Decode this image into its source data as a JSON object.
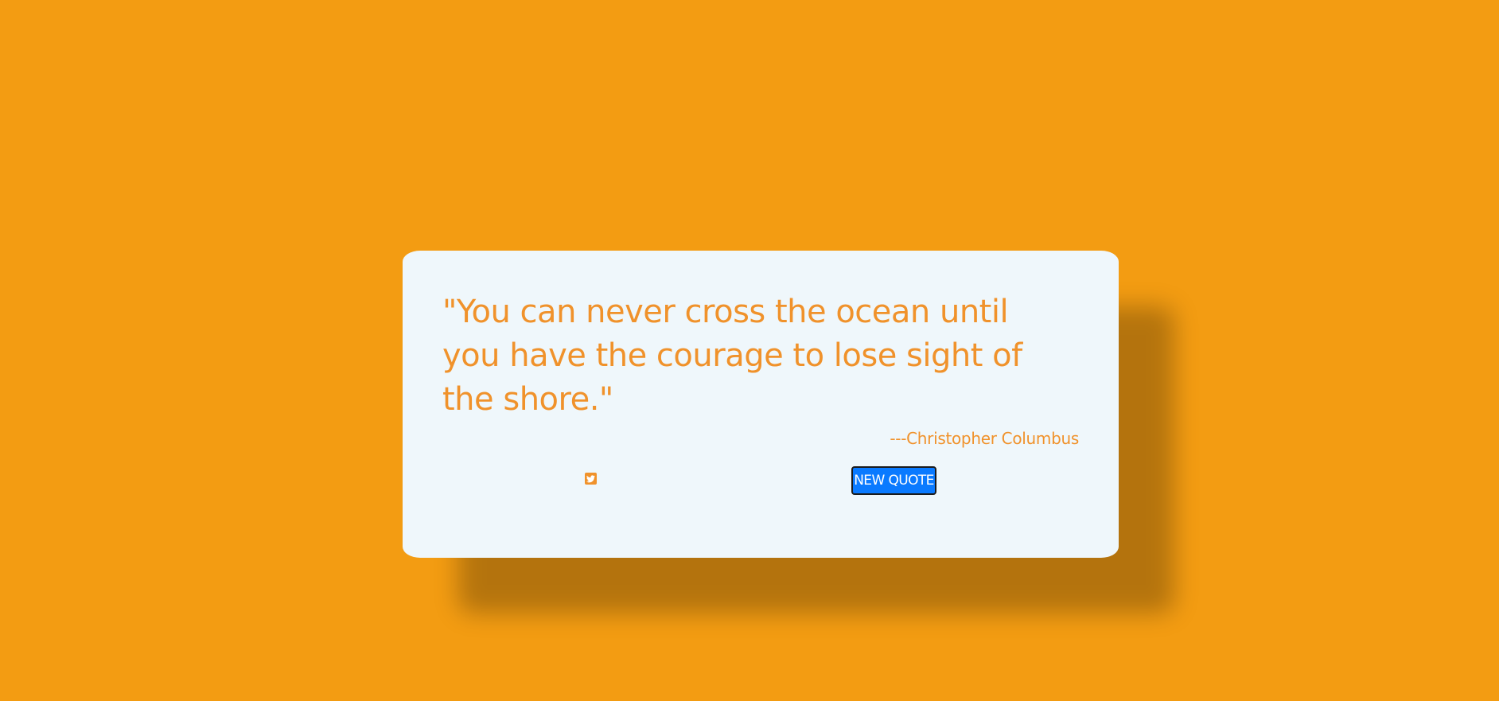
{
  "colors": {
    "background": "#f39c12",
    "card": "#eff7fb",
    "accent_text": "#f0922b",
    "button": "#0a7aff",
    "button_text": "#ffffff"
  },
  "quote": {
    "text": "\"You can never cross the ocean until you have the courage to lose sight of the shore.\"",
    "author": "---Christopher Columbus"
  },
  "actions": {
    "tweet_icon": "twitter-icon",
    "new_quote_label": "NEW QUOTE"
  }
}
